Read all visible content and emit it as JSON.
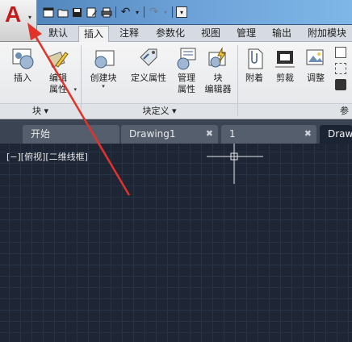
{
  "app_menu": {
    "dropdown": "▾"
  },
  "qat": {
    "new": "▭",
    "open": "▱",
    "save": "▤",
    "saveas": "▣",
    "print": "⎙",
    "undo": "↶",
    "undo_dd": "▾",
    "redo": "↷",
    "redo_dd": "▾",
    "customize": "▾"
  },
  "tabs": [
    "默认",
    "插入",
    "注释",
    "参数化",
    "视图",
    "管理",
    "输出",
    "附加模块"
  ],
  "ribbon": {
    "insert": "插入",
    "edit_attr_1": "编辑",
    "edit_attr_2": "属性",
    "create_block": "创建块",
    "define_attr": "定义属性",
    "manage_attr_1": "管理",
    "manage_attr_2": "属性",
    "block_editor_1": "块",
    "block_editor_2": "编辑器",
    "attach": "附着",
    "clip": "剪裁",
    "adjust": "调整",
    "panel_block": "块 ▾",
    "panel_block_def": "块定义 ▾",
    "panel_ref": "参"
  },
  "doc_tabs": [
    "开始",
    "Drawing1",
    "1",
    "Draw"
  ],
  "viewport_label": "[−][俯视][二维线框]",
  "colors": {
    "accent": "#c41a1a",
    "canvas": "#1e2636",
    "annotation_arrow": "#e2332b"
  }
}
